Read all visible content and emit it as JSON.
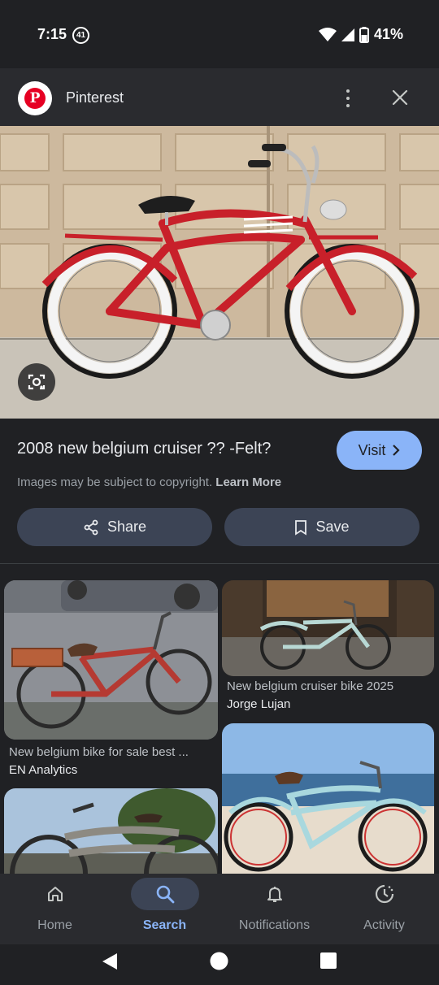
{
  "status": {
    "time": "7:15",
    "notif_count": "41",
    "battery": "41%"
  },
  "header": {
    "source": "Pinterest"
  },
  "result": {
    "title": "2008 new belgium cruiser ?? -Felt?",
    "visit_label": "Visit",
    "copyright_text": "Images may be subject to copyright.",
    "learn_more": "Learn More",
    "share_label": "Share",
    "save_label": "Save"
  },
  "related": [
    {
      "title": "New belgium bike for sale best ...",
      "source": "EN Analytics"
    },
    {
      "title": "New belgium cruiser bike 2025",
      "source": "Jorge Lujan"
    }
  ],
  "nav": {
    "items": [
      {
        "label": "Home",
        "icon": "home-icon"
      },
      {
        "label": "Search",
        "icon": "search-icon",
        "active": true
      },
      {
        "label": "Notifications",
        "icon": "bell-icon"
      },
      {
        "label": "Activity",
        "icon": "activity-icon"
      }
    ]
  },
  "colors": {
    "accent": "#8ab4f8",
    "background": "#202124",
    "button": "#3c4455",
    "bike_red": "#c8202a"
  }
}
